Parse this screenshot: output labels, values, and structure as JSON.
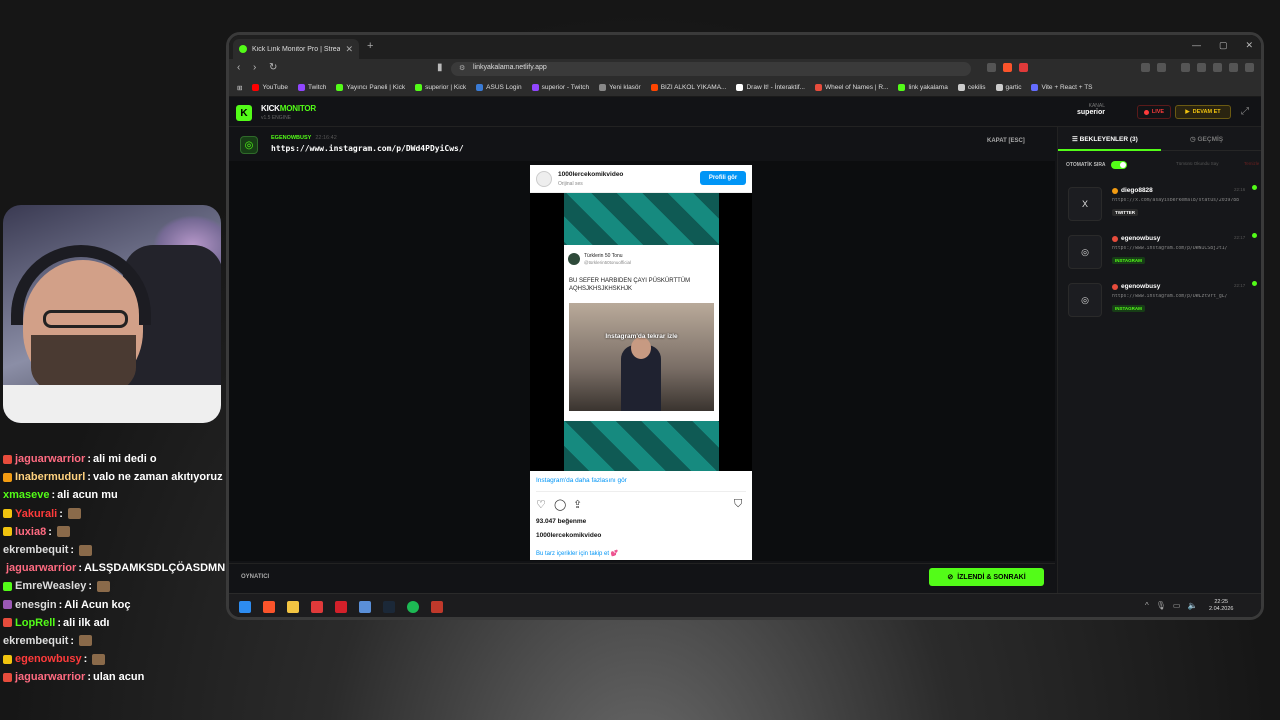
{
  "browser": {
    "tab_title": "Kick Link Monitor Pro | Stream D",
    "url": "linkyakalama.netlify.app",
    "bookmarks": [
      {
        "label": "YouTube",
        "color": "#ff0000"
      },
      {
        "label": "Twitch",
        "color": "#9146ff"
      },
      {
        "label": "Yayıncı Paneli | Kick",
        "color": "#53fc18"
      },
      {
        "label": "superior | Kick",
        "color": "#53fc18"
      },
      {
        "label": "ASUS Login",
        "color": "#3a7bd5"
      },
      {
        "label": "superior - Twitch",
        "color": "#9146ff"
      },
      {
        "label": "Yeni klasör",
        "color": "#888888"
      },
      {
        "label": "BIZI ALKOL YIKAMA...",
        "color": "#ff4500"
      },
      {
        "label": "Draw It! - İnteraktif...",
        "color": "#ffffff"
      },
      {
        "label": "Wheel of Names | R...",
        "color": "#e74c3c"
      },
      {
        "label": "link yakalama",
        "color": "#53fc18"
      },
      {
        "label": "cekilis",
        "color": "#cccccc"
      },
      {
        "label": "gartic",
        "color": "#cccccc"
      },
      {
        "label": "Vite + React + TS",
        "color": "#646cff"
      }
    ]
  },
  "app": {
    "brand_a": "KICK",
    "brand_b": "MONITOR",
    "version": "v1.5 ENGINE",
    "channel_label": "KANAL",
    "channel": "superior",
    "live_label": "LIVE",
    "continue_label": "DEVAM ET",
    "current": {
      "username": "EGENOWBUSY",
      "time": "22:16:42",
      "url": "https://www.instagram.com/p/DWd4PDyiCws/",
      "close_label": "KAPAT [ESC]"
    },
    "player_label": "OYNATICI",
    "next_label": "İZLENDİ & SONRAKİ"
  },
  "embed": {
    "account": "1000lercekomikvideo",
    "subtitle": "Orijinal ses",
    "profile_button": "Profili gör",
    "tweet_name": "Türklerin 50 Tonu",
    "tweet_handle": "@türklerin50tonuofficial",
    "tweet_text": "BU SEFER HARBIDEN ÇAYI PÜSKÜRTTÜM AQHSJKHSJKHSKHJK",
    "video_caption": "Instagram'da tekrar izle",
    "more_link": "Instagram'da daha fazlasını gör",
    "likes": "93.047 beğenme",
    "caption_user": "1000lercekomikvideo",
    "follow_text": "Bu tarz içerikler için takip et 💕"
  },
  "side": {
    "tab_waiting": "BEKLEYENLER (3)",
    "tab_history": "GEÇMİŞ",
    "auto_label": "OTOMATİK SIRA",
    "mark_read": "Tümünü Okundu Say",
    "clear": "Temizle",
    "items": [
      {
        "user": "diego8828",
        "time": "22:16",
        "url": "https://x.com/asayisberkemal8/status/2039788",
        "platform": "TWITTER",
        "thumb": "X",
        "dot": "#f39c12",
        "pill_bg": "#2a2a2a",
        "pill_fg": "#ffffff"
      },
      {
        "user": "egenowbusy",
        "time": "22:17",
        "url": "https://www.instagram.com/p/DWN1CS8jJt1/",
        "platform": "INSTAGRAM",
        "thumb": "◎",
        "dot": "#e74c3c",
        "pill_bg": "#173d16",
        "pill_fg": "#53fc18"
      },
      {
        "user": "egenowbusy",
        "time": "22:17",
        "url": "https://www.instagram.com/p/DWLzt9Yt_gL/",
        "platform": "INSTAGRAM",
        "thumb": "◎",
        "dot": "#e74c3c",
        "pill_bg": "#173d16",
        "pill_fg": "#53fc18"
      }
    ]
  },
  "taskbar": {
    "time": "22:25",
    "date": "2.04.2026"
  },
  "chat": [
    {
      "user": "jaguarwarrior",
      "text": "ali mi dedi o",
      "color": "#ff6b81",
      "badge": "#e74c3c"
    },
    {
      "user": "Inabermudurl",
      "text": "valo ne zaman akıtıyoruz",
      "color": "#ffd27f",
      "badge": "#f39c12"
    },
    {
      "user": "xmaseve",
      "text": "ali acun mu",
      "color": "#53fc18",
      "badge": ""
    },
    {
      "user": "Yakurali",
      "text": "",
      "color": "#ff3b3b",
      "badge": "#f1c40f"
    },
    {
      "user": "luxia8",
      "text": "",
      "color": "#ff6b81",
      "badge": "#f1c40f"
    },
    {
      "user": "ekrembequit",
      "text": "",
      "color": "#dddddd",
      "badge": ""
    },
    {
      "user": "jaguarwarrior",
      "text": "ALSŞDAMKSDLÇÖASDMNI",
      "color": "#ff6b81",
      "badge": "#e74c3c"
    },
    {
      "user": "EmreWeasley",
      "text": "",
      "color": "#dddddd",
      "badge": "#53fc18"
    },
    {
      "user": "enesgin",
      "text": "Ali Acun koç",
      "color": "#dddddd",
      "badge": "#9b59b6"
    },
    {
      "user": "LopRell",
      "text": "ali ilk adı",
      "color": "#53fc18",
      "badge": "#e74c3c"
    },
    {
      "user": "ekrembequit",
      "text": "",
      "color": "#dddddd",
      "badge": ""
    },
    {
      "user": "egenowbusy",
      "text": "",
      "color": "#ff3b3b",
      "badge": "#f1c40f"
    },
    {
      "user": "jaguarwarrior",
      "text": "ulan acun",
      "color": "#ff6b81",
      "badge": "#e74c3c"
    }
  ]
}
